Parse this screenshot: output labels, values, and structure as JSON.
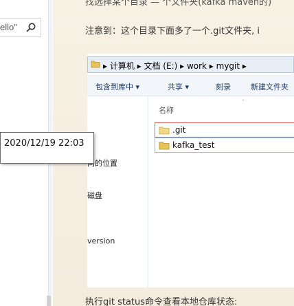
{
  "sidebar": {
    "search_text": "ello\"",
    "search_icon": "search-icon"
  },
  "article": {
    "top_line": "找选择某个目录 — 个文件夹(kafka maven的)",
    "note_line": "注意到：这个目录下面多了一个.git文件夹, i",
    "bottom_line": "执行git status命令查看本地仓库状态:"
  },
  "explorer": {
    "address_path": "▸ 计算机 ▸ 文档 (E:) ▸ work ▸ mygit ▸",
    "toolbar": [
      "包含到库中 ▾",
      "共享 ▾",
      "刻录",
      "新建文件夹"
    ],
    "nav_fragments": [
      "问的位置",
      "磁盘",
      "version"
    ],
    "column_header": "名称",
    "files": [
      {
        "name": ".git",
        "icon": "folder-icon"
      },
      {
        "name": "kafka_test",
        "icon": "folder-icon"
      }
    ]
  },
  "tooltip": {
    "text": "2020/12/19 22:03"
  },
  "colors": {
    "parchment": "#f6efe1",
    "highlight_red": "#e36464",
    "folder_yellow": "#e8c35a"
  }
}
